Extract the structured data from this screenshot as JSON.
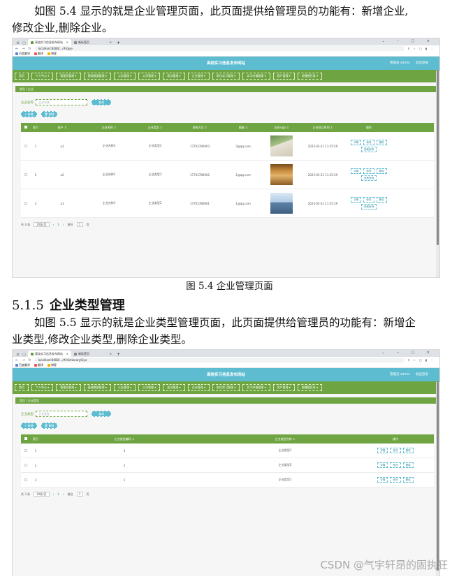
{
  "doc": {
    "para1_a": "如图 5.4 显示的就是企业管理页面，此页面提供给管理员的功能有：新增企业,",
    "para1_b": "修改企业,删除企业。",
    "caption1": "图 5.4 企业管理页面",
    "heading_num": "5.1.5",
    "heading_text": "企业类型管理",
    "para2_a": "如图 5.5 显示的就是企业类型管理页面，此页面提供给管理员的功能有：新增企",
    "para2_b": "业类型,修改企业类型,删除企业类型。",
    "watermark": "CSDN @气宇轩昂的固执狂"
  },
  "browser1": {
    "tab_active": "高校实习信息发布网站",
    "tab_other": "新标签页",
    "url": "localhost:8080/.../#/qiye",
    "bookmark_1": "百度翻译",
    "bookmark_2": "翻译",
    "bookmark_3": "博客"
  },
  "browser2": {
    "tab_active": "高校实习信息发布网站",
    "tab_other": "新标签页",
    "url": "localhost:8080/.../#/dictionaryQiye",
    "bookmark_1": "百度翻译",
    "bookmark_2": "翻译",
    "bookmark_3": "博客"
  },
  "app": {
    "title": "高校实习信息发布网站",
    "user": "管理员 admin",
    "logout": "退出登录",
    "menu": [
      "首页",
      "个人中心 ▾",
      "管理员管理 ▾",
      "基础数据管理 ▾",
      "公告管理 ▾",
      "公司管理 ▾",
      "面试管理 ▾",
      "企业管理 ▾",
      "职位实习管理 ▾",
      "实习申请管理 ▾",
      "用户管理 ▾",
      "轮播图目录 ▾"
    ],
    "add_label": "+ 新增",
    "delete_label": "🗑 删除",
    "query_label": "查询",
    "op_detail": "详情",
    "op_edit": "修改",
    "op_delete": "删除",
    "op_view": "查看官网"
  },
  "page1": {
    "crumb": "首页 / 企业",
    "filter_label": "企业名称",
    "filter_placeholder": "企业名称",
    "headers": [
      "索引",
      "账户 ⇕",
      "企业名称 ⇕",
      "企业类型 ⇕",
      "联系方式 ⇕",
      "邮箱 ⇕",
      "企业logo ⇕",
      "企业成立时间 ⇕",
      "操作"
    ],
    "rows": [
      {
        "idx": "1",
        "account": "a3",
        "name": "企业名称3",
        "type": "企业类型3",
        "phone": "17703786903",
        "email": "3@qq.com",
        "time": "2023-03-31 11:35:59"
      },
      {
        "idx": "2",
        "account": "a2",
        "name": "企业名称2",
        "type": "企业类型3",
        "phone": "17703786902",
        "email": "2@qq.com",
        "time": "2023-03-31 11:35:59"
      },
      {
        "idx": "3",
        "account": "a1",
        "name": "企业名称1",
        "type": "企业类型2",
        "phone": "17703786901",
        "email": "1@qq.com",
        "time": "2023-03-31 11:35:59"
      }
    ],
    "pager_total": "共 3 条",
    "pager_size": "10条/页",
    "pager_page": "1",
    "pager_goto": "前往",
    "pager_goto_val": "1",
    "pager_unit": "页"
  },
  "page2": {
    "crumb": "首页 / 企业类型",
    "filter_label": "企业类型",
    "filter_placeholder": "企业类型",
    "headers": [
      "索引",
      "企业类型编码 ⇕",
      "企业类型名称 ⇕",
      "操作"
    ],
    "rows": [
      {
        "idx": "1",
        "code": "3",
        "name": "企业类型3"
      },
      {
        "idx": "2",
        "code": "2",
        "name": "企业类型2"
      },
      {
        "idx": "3",
        "code": "1",
        "name": "企业类型1"
      }
    ],
    "pager_total": "共 3 条",
    "pager_size": "10条/页",
    "pager_page": "1",
    "pager_goto": "前往",
    "pager_goto_val": "1",
    "pager_unit": "页"
  }
}
